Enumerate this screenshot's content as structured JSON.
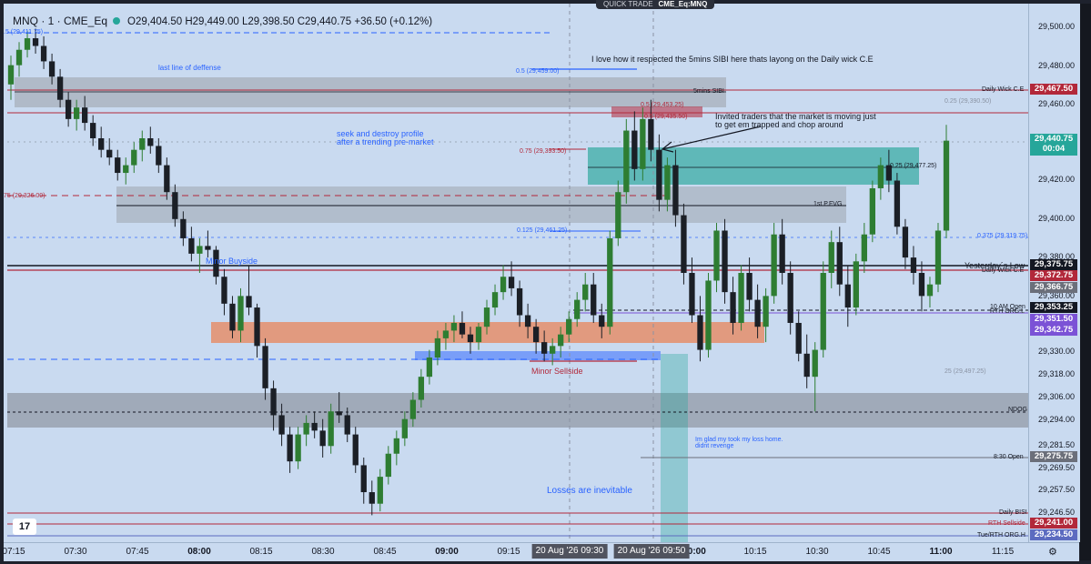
{
  "header": {
    "symbol": "MNQ · 1 · CME_Eq",
    "ohlc": "O29,404.50 H29,449.00 L29,398.50 C29,440.75 +36.50 (+0.12%)",
    "quick_trade": "QUICK TRADE",
    "quick_trade_symbol": "CME_Eq:MNQ"
  },
  "price_scale": {
    "ticks": [
      "29,500.00",
      "29,480.00",
      "29,460.00",
      "29,420.00",
      "29,400.00",
      "29,380.00",
      "29,360.00",
      "29,330.00",
      "29,318.00",
      "29,306.00",
      "29,294.00",
      "29,281.50",
      "29,269.50",
      "29,257.50",
      "29,246.50"
    ],
    "tick_values": [
      29500,
      29480,
      29460,
      29420,
      29400,
      29380,
      29360,
      29330,
      29318,
      29306,
      29294,
      29281.5,
      29269.5,
      29257.5,
      29246.5
    ],
    "labels": [
      {
        "text": "29,467.50",
        "color": "#b2283a"
      },
      {
        "text": "29,440.75",
        "sub": "00:04",
        "color": "#26a69a"
      },
      {
        "text": "29,375.75",
        "color": "#131722"
      },
      {
        "text": "29,372.75",
        "color": "#b2283a"
      },
      {
        "text": "29,366.75",
        "color": "#6b6f7a"
      },
      {
        "text": "29,353.25",
        "color": "#131722"
      },
      {
        "text": "29,351.50",
        "color": "#7b52d6"
      },
      {
        "text": "29,342.75",
        "color": "#7b52d6"
      },
      {
        "text": "29,275.75",
        "color": "#6b6f7a"
      },
      {
        "text": "29,241.00",
        "color": "#b2283a"
      },
      {
        "text": "29,234.50",
        "color": "#5c6bc0"
      }
    ]
  },
  "time_axis": {
    "ticks": [
      "07:15",
      "07:30",
      "07:45",
      "08:00",
      "08:15",
      "08:30",
      "08:45",
      "09:00",
      "09:15",
      "09:30",
      "10:00",
      "10:15",
      "10:30",
      "10:45",
      "11:00",
      "11:15"
    ],
    "bold": [
      "08:00",
      "09:00",
      "10:00",
      "11:00"
    ],
    "badges": [
      "20 Aug '26  09:30",
      "20 Aug '26  09:50"
    ]
  },
  "chart_data": {
    "type": "candlestick",
    "title": "MNQ · 1 · CME_Eq",
    "xlabel": "",
    "ylabel": "",
    "ylim": [
      29232,
      29512
    ],
    "candles_ohlc": [
      [
        29470,
        29485,
        29462,
        29480
      ],
      [
        29480,
        29492,
        29474,
        29488
      ],
      [
        29488,
        29498,
        29484,
        29494
      ],
      [
        29494,
        29499,
        29486,
        29490
      ],
      [
        29490,
        29495,
        29478,
        29482
      ],
      [
        29482,
        29486,
        29470,
        29474
      ],
      [
        29474,
        29478,
        29458,
        29462
      ],
      [
        29462,
        29466,
        29448,
        29452
      ],
      [
        29452,
        29462,
        29446,
        29458
      ],
      [
        29458,
        29464,
        29446,
        29450
      ],
      [
        29450,
        29454,
        29438,
        29442
      ],
      [
        29442,
        29448,
        29432,
        29436
      ],
      [
        29436,
        29442,
        29428,
        29432
      ],
      [
        29432,
        29436,
        29420,
        29424
      ],
      [
        29424,
        29432,
        29418,
        29428
      ],
      [
        29428,
        29440,
        29424,
        29436
      ],
      [
        29436,
        29446,
        29430,
        29442
      ],
      [
        29442,
        29448,
        29434,
        29438
      ],
      [
        29438,
        29442,
        29424,
        29428
      ],
      [
        29428,
        29432,
        29410,
        29414
      ],
      [
        29414,
        29418,
        29396,
        29400
      ],
      [
        29400,
        29404,
        29386,
        29390
      ],
      [
        29390,
        29396,
        29378,
        29382
      ],
      [
        29382,
        29390,
        29372,
        29386
      ],
      [
        29386,
        29394,
        29380,
        29384
      ],
      [
        29384,
        29386,
        29366,
        29370
      ],
      [
        29370,
        29374,
        29350,
        29356
      ],
      [
        29356,
        29360,
        29338,
        29342
      ],
      [
        29342,
        29364,
        29336,
        29360
      ],
      [
        29360,
        29376,
        29350,
        29354
      ],
      [
        29354,
        29356,
        29328,
        29334
      ],
      [
        29334,
        29338,
        29306,
        29312
      ],
      [
        29312,
        29316,
        29290,
        29298
      ],
      [
        29298,
        29304,
        29282,
        29288
      ],
      [
        29288,
        29292,
        29268,
        29274
      ],
      [
        29274,
        29292,
        29270,
        29288
      ],
      [
        29288,
        29298,
        29282,
        29294
      ],
      [
        29294,
        29300,
        29286,
        29290
      ],
      [
        29290,
        29296,
        29276,
        29282
      ],
      [
        29282,
        29304,
        29278,
        29300
      ],
      [
        29300,
        29310,
        29294,
        29298
      ],
      [
        29298,
        29302,
        29284,
        29288
      ],
      [
        29288,
        29292,
        29268,
        29272
      ],
      [
        29272,
        29276,
        29252,
        29258
      ],
      [
        29258,
        29264,
        29246,
        29252
      ],
      [
        29252,
        29270,
        29248,
        29266
      ],
      [
        29266,
        29282,
        29262,
        29278
      ],
      [
        29278,
        29290,
        29272,
        29286
      ],
      [
        29286,
        29300,
        29282,
        29296
      ],
      [
        29296,
        29310,
        29292,
        29306
      ],
      [
        29306,
        29322,
        29302,
        29318
      ],
      [
        29318,
        29332,
        29314,
        29328
      ],
      [
        29328,
        29342,
        29324,
        29338
      ],
      [
        29338,
        29346,
        29332,
        29342
      ],
      [
        29342,
        29350,
        29336,
        29346
      ],
      [
        29346,
        29352,
        29338,
        29340
      ],
      [
        29340,
        29344,
        29330,
        29336
      ],
      [
        29336,
        29346,
        29332,
        29344
      ],
      [
        29344,
        29358,
        29340,
        29354
      ],
      [
        29354,
        29366,
        29350,
        29362
      ],
      [
        29362,
        29376,
        29358,
        29370
      ],
      [
        29370,
        29378,
        29360,
        29364
      ],
      [
        29364,
        29368,
        29344,
        29350
      ],
      [
        29350,
        29356,
        29338,
        29344
      ],
      [
        29344,
        29348,
        29330,
        29336
      ],
      [
        29336,
        29342,
        29326,
        29330
      ],
      [
        29330,
        29338,
        29324,
        29334
      ],
      [
        29334,
        29344,
        29328,
        29340
      ],
      [
        29340,
        29352,
        29336,
        29348
      ],
      [
        29348,
        29362,
        29344,
        29358
      ],
      [
        29358,
        29372,
        29352,
        29366
      ],
      [
        29366,
        29372,
        29346,
        29350
      ],
      [
        29350,
        29356,
        29338,
        29344
      ],
      [
        29344,
        29394,
        29340,
        29390
      ],
      [
        29390,
        29420,
        29386,
        29414
      ],
      [
        29414,
        29452,
        29408,
        29446
      ],
      [
        29446,
        29456,
        29420,
        29426
      ],
      [
        29426,
        29458,
        29420,
        29452
      ],
      [
        29452,
        29462,
        29430,
        29436
      ],
      [
        29436,
        29444,
        29404,
        29410
      ],
      [
        29410,
        29432,
        29404,
        29428
      ],
      [
        29428,
        29436,
        29396,
        29402
      ],
      [
        29402,
        29408,
        29366,
        29372
      ],
      [
        29372,
        29380,
        29346,
        29350
      ],
      [
        29350,
        29360,
        29326,
        29332
      ],
      [
        29332,
        29372,
        29328,
        29368
      ],
      [
        29368,
        29398,
        29362,
        29394
      ],
      [
        29394,
        29400,
        29356,
        29362
      ],
      [
        29362,
        29370,
        29340,
        29346
      ],
      [
        29346,
        29376,
        29342,
        29372
      ],
      [
        29372,
        29380,
        29352,
        29358
      ],
      [
        29358,
        29366,
        29338,
        29344
      ],
      [
        29344,
        29364,
        29336,
        29360
      ],
      [
        29360,
        29398,
        29356,
        29392
      ],
      [
        29392,
        29400,
        29366,
        29372
      ],
      [
        29372,
        29378,
        29340,
        29346
      ],
      [
        29346,
        29352,
        29326,
        29330
      ],
      [
        29330,
        29340,
        29312,
        29318
      ],
      [
        29318,
        29336,
        29300,
        29332
      ],
      [
        29332,
        29378,
        29328,
        29372
      ],
      [
        29372,
        29394,
        29364,
        29388
      ],
      [
        29388,
        29396,
        29360,
        29366
      ],
      [
        29366,
        29376,
        29344,
        29354
      ],
      [
        29354,
        29382,
        29350,
        29378
      ],
      [
        29378,
        29398,
        29372,
        29392
      ],
      [
        29392,
        29420,
        29388,
        29416
      ],
      [
        29416,
        29432,
        29410,
        29428
      ],
      [
        29428,
        29436,
        29414,
        29420
      ],
      [
        29420,
        29424,
        29392,
        29396
      ],
      [
        29396,
        29400,
        29374,
        29380
      ],
      [
        29380,
        29386,
        29366,
        29372
      ],
      [
        29372,
        29378,
        29352,
        29360
      ],
      [
        29360,
        29370,
        29354,
        29366
      ],
      [
        29366,
        29398,
        29362,
        29394
      ],
      [
        29394,
        29449,
        29390,
        29440.75
      ]
    ],
    "annotations": [
      "last line of deffense",
      "seek and destroy profile",
      "after a trending pre-market",
      "I love how it respected the 5mins SIBI here thats layong on the Daily wick C.E",
      "Invited traders that the market is moving just",
      "to get em trapped and chop around",
      "Minor Buyside",
      "Minor Sellside",
      "Losses are inevitable",
      "Im glad my took my loss home.",
      "didnt revenge",
      "5mins SIBI",
      "1st P.FVG",
      "0.25 (29,477.25)",
      "0.5 (29,459.00)",
      "0.5 (29,453.25)",
      "0.5 (29,435.50)",
      "0.75 (29,393.50)",
      "0.125 (29,461.25)",
      "0.25 (29,390.50)",
      "0.375 (29,319.75)",
      "25 (29,497.25)",
      ".5 (29,411.75)",
      "75 (29,326.00)"
    ],
    "line_labels": [
      "Daily Wick C.E",
      "Yesterday´s Low",
      "Daily Wick C.E",
      "10 AM Open",
      "RTH ORG.L",
      "NDOG",
      "8:30 Open",
      "Daily BISI",
      "RTH Sellside",
      "Tue/RTH ORG.H"
    ],
    "levels": {
      "daily_wick_ce": 29467.5,
      "yesterday_low": 29375.75,
      "daily_wick_ce_2": 29372.75,
      "ten_am_open": 29353.25,
      "rth_org_l": 29351.5,
      "eight_thirty_open": 29275.75,
      "daily_bisi": 29244,
      "rth_sellside": 29241,
      "tue_rth_org_h": 29234.5,
      "ndog": 29298
    }
  },
  "colors": {
    "bull": "#2e7d32",
    "bear": "#1b1f26",
    "chart_bg": "#c9daf0",
    "red_line": "#b2283a",
    "blue_dash": "#2962ff",
    "gray_zone": "#9aa0a8",
    "orange_zone": "#e8845a",
    "teal_zone": "#26a69a",
    "purple": "#7b52d6"
  }
}
